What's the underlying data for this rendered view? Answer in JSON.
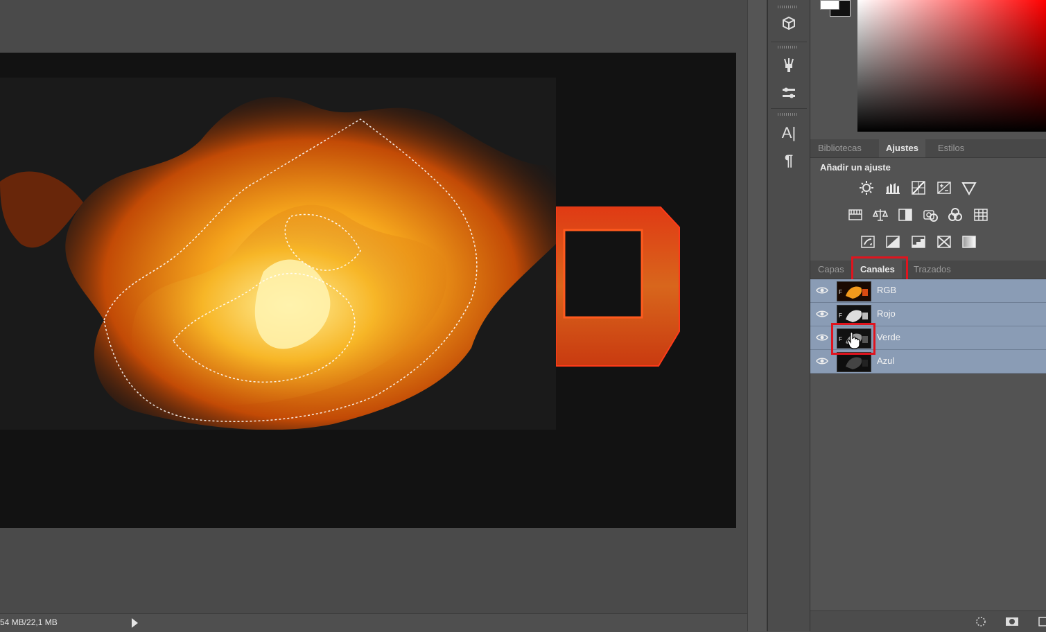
{
  "status": {
    "doc_size": "54 MB/22,1 MB"
  },
  "tools": [
    {
      "icon": "3d-cube-icon"
    },
    {
      "icon": "brush-presets-icon"
    },
    {
      "icon": "adjustment-sliders-icon"
    },
    {
      "icon": "character-text-icon",
      "glyph": "A|"
    },
    {
      "icon": "paragraph-icon",
      "glyph": "¶"
    }
  ],
  "adjust_tabs": [
    "Bibliotecas",
    "Ajustes",
    "Estilos"
  ],
  "adjust_active": "Ajustes",
  "adjust_title": "Añadir un ajuste",
  "adjust_icons": [
    [
      "brightness-contrast-icon",
      "levels-icon",
      "curves-icon",
      "exposure-icon",
      "vibrance-icon"
    ],
    [
      "hue-saturation-icon",
      "color-balance-icon",
      "black-white-icon",
      "photo-filter-icon",
      "channel-mixer-icon",
      "color-lookup-icon"
    ],
    [
      "invert-icon",
      "posterize-icon",
      "threshold-icon",
      "selective-color-icon",
      "gradient-map-icon"
    ]
  ],
  "channel_tabs": [
    "Capas",
    "Canales",
    "Trazados"
  ],
  "channel_active": "Canales",
  "channels": [
    {
      "label": "RGB",
      "thumb": "rgb"
    },
    {
      "label": "Rojo",
      "thumb": "gray-bright"
    },
    {
      "label": "Verde",
      "thumb": "gray-mid"
    },
    {
      "label": "Azul",
      "thumb": "gray-dark"
    }
  ],
  "colors": {
    "highlight": "#e0141e",
    "channel_row": "#8a9cb5",
    "fire_core": "#ffd23a",
    "fire_outer": "#c24a06"
  }
}
